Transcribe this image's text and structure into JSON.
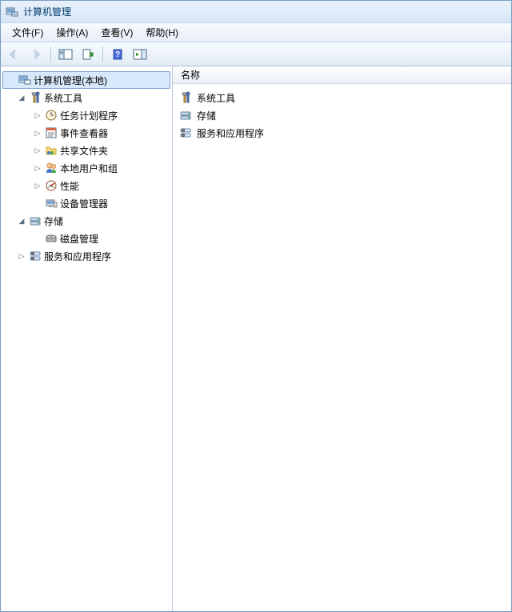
{
  "window": {
    "title": "计算机管理"
  },
  "menu": {
    "file": "文件(F)",
    "action": "操作(A)",
    "view": "查看(V)",
    "help": "帮助(H)"
  },
  "tree": {
    "root": "计算机管理(本地)",
    "system_tools": "系统工具",
    "task_scheduler": "任务计划程序",
    "event_viewer": "事件查看器",
    "shared_folders": "共享文件夹",
    "local_users": "本地用户和组",
    "performance": "性能",
    "device_manager": "设备管理器",
    "storage": "存储",
    "disk_management": "磁盘管理",
    "services_apps": "服务和应用程序"
  },
  "list": {
    "header_name": "名称",
    "items": {
      "system_tools": "系统工具",
      "storage": "存储",
      "services_apps": "服务和应用程序"
    }
  }
}
